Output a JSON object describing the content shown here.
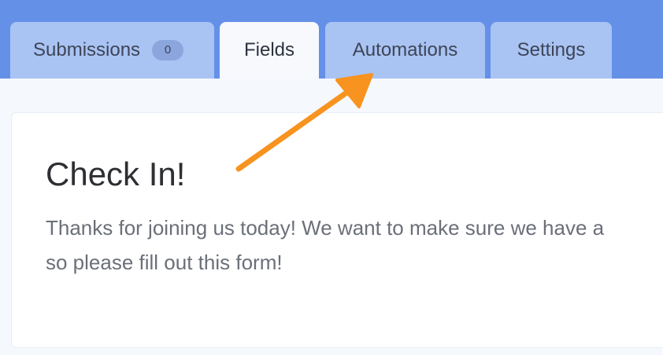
{
  "tabs": {
    "submissions": {
      "label": "Submissions",
      "count": "0"
    },
    "fields": {
      "label": "Fields"
    },
    "automations": {
      "label": "Automations"
    },
    "settings": {
      "label": "Settings"
    }
  },
  "form": {
    "title": "Check In!",
    "description_line1": "Thanks for joining us today! We want to make sure we have a",
    "description_line2": "so please fill out this form!"
  },
  "annotation": {
    "icon": "arrow-icon",
    "color": "#f7931e"
  },
  "colors": {
    "header": "#6590e8",
    "tab_inactive": "#a9c3f3",
    "tab_active": "#f7f9fd"
  }
}
